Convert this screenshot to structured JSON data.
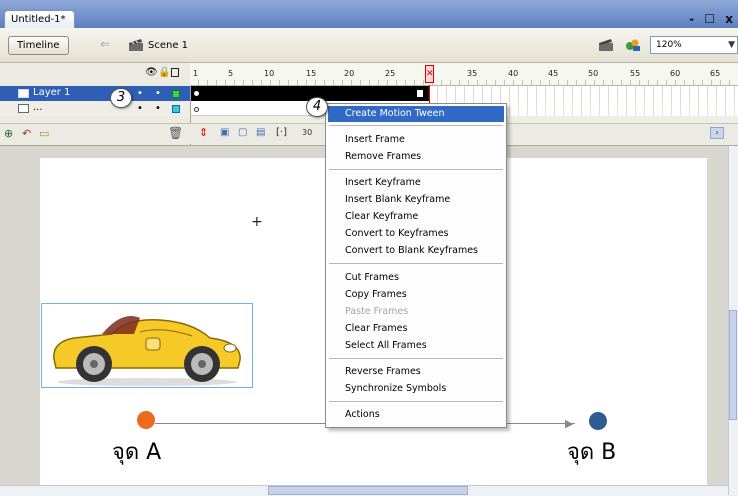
{
  "window": {
    "doc_tab": "Untitled-1*",
    "controls": "- ☐ x"
  },
  "editbar": {
    "timeline_button": "Timeline",
    "scene_label": "Scene 1",
    "zoom": "120%"
  },
  "timeline": {
    "ruler_numbers": [
      "1",
      "5",
      "10",
      "15",
      "20",
      "25",
      "35",
      "40",
      "45",
      "50",
      "55",
      "60",
      "65"
    ],
    "layers": [
      {
        "name": "Layer 1"
      },
      {
        "name": "..."
      }
    ],
    "fps": "30"
  },
  "stage": {
    "point_a_label": "จุด A",
    "point_b_label": "จุด B"
  },
  "badges": {
    "step3": "3",
    "step4": "4"
  },
  "context_menu": {
    "items": [
      "Create Motion Tween",
      "Insert Frame",
      "Remove Frames",
      "Insert Keyframe",
      "Insert Blank Keyframe",
      "Clear Keyframe",
      "Convert to Keyframes",
      "Convert to Blank Keyframes",
      "Cut Frames",
      "Copy Frames",
      "Paste Frames",
      "Clear Frames",
      "Select All Frames",
      "Reverse Frames",
      "Synchronize Symbols",
      "Actions"
    ],
    "highlighted": "Create Motion Tween",
    "disabled": [
      "Paste Frames"
    ]
  },
  "colors": {
    "point_a": "#ee6a1c",
    "point_b": "#2d5b93",
    "selection": "#316ac5"
  }
}
